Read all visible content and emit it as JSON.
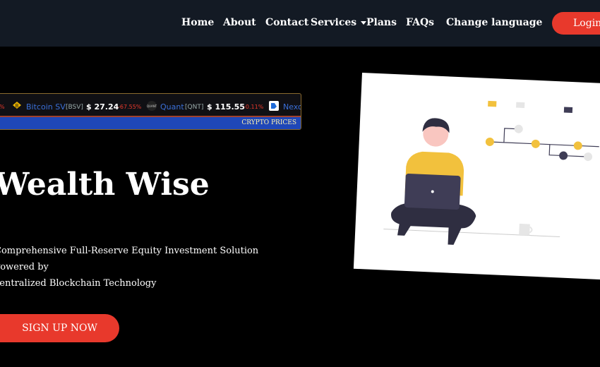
{
  "nav": {
    "items": [
      "Home",
      "About",
      "Contact",
      "Services",
      "Plans",
      "FAQs",
      "Change language"
    ],
    "login_label": "Login"
  },
  "ticker": {
    "lead_fragment": "%",
    "entries": [
      {
        "name": "Bitcoin SV",
        "symbol": "[BSV]",
        "price": "$ 27.24",
        "change": "-67.55%"
      },
      {
        "name": "Quant",
        "symbol": "[QNT]",
        "price": "$ 115.55",
        "change": "-0.11%"
      },
      {
        "name": "Nexo",
        "symbol": "",
        "price": "",
        "change": ""
      }
    ],
    "footer_label": "CRYPTO PRICES",
    "quant_logo_text": "QUANT"
  },
  "hero": {
    "title": "Wealth Wise",
    "subtitle_line1": "Comprehensive Full-Reserve Equity Investment Solution Powered by",
    "subtitle_line2": "centralized Blockchain Technology",
    "cta_label": "SIGN UP NOW"
  },
  "colors": {
    "accent": "#e8392c",
    "nav_bg": "#131a24",
    "ticker_footer": "#1f47b8",
    "illustration_yellow": "#f2c13d",
    "illustration_dark": "#3f3d56"
  }
}
